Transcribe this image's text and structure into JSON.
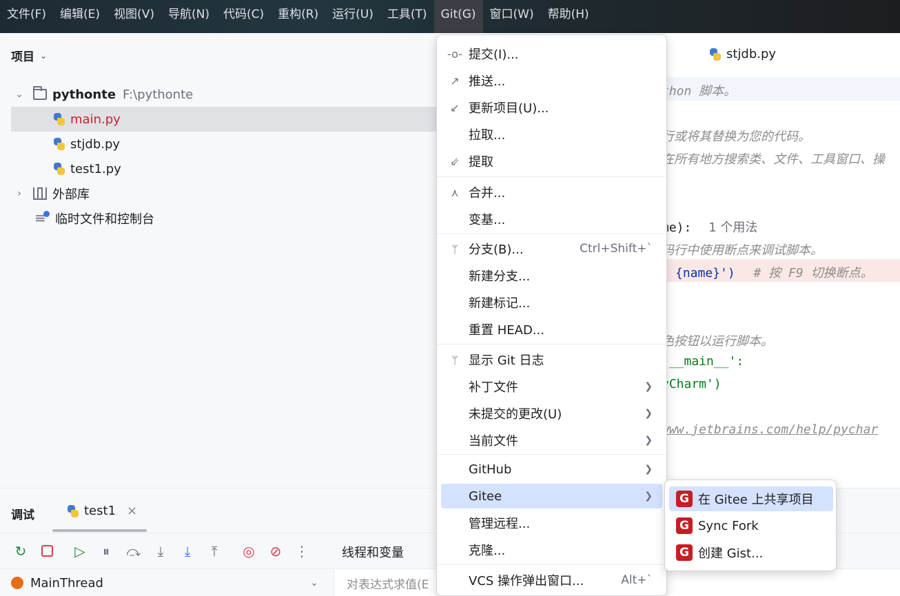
{
  "menubar": {
    "items": [
      "文件(F)",
      "编辑(E)",
      "视图(V)",
      "导航(N)",
      "代码(C)",
      "重构(R)",
      "运行(U)",
      "工具(T)",
      "Git(G)",
      "窗口(W)",
      "帮助(H)"
    ]
  },
  "project": {
    "title": "项目",
    "root_name": "pythonte",
    "root_path": "F:\\pythonte",
    "files": [
      "main.py",
      "stjdb.py",
      "test1.py"
    ],
    "external_libs": "外部库",
    "scratches": "临时文件和控制台"
  },
  "editor": {
    "tab": "stjdb.py",
    "lines": {
      "l1": "thon 脚本。",
      "l2": "行或将其替换为您的代码。",
      "l3": "在所有地方搜索类、文件、工具窗口、操",
      "l4_code": "me):",
      "l4_hint": "1 个用法",
      "l5": "码行中使用断点来调试脚本。",
      "l6_code": "{name}')",
      "l6_comment": "# 按 F9 切换断点。",
      "l7": "色按钮以运行脚本。",
      "l8": "'__main__':",
      "l9": "yCharm')",
      "l10": "www.jetbrains.com/help/pychar"
    }
  },
  "debug": {
    "title": "调试",
    "tab": "test1",
    "threads_tab": "线程和变量",
    "thread": "MainThread",
    "eval_placeholder": "对表达式求值(E"
  },
  "git_menu": {
    "commit": "提交(I)...",
    "push": "推送...",
    "update": "更新项目(U)...",
    "pull": "拉取...",
    "fetch": "提取",
    "merge": "合并...",
    "rebase": "变基...",
    "branches": "分支(B)...",
    "branches_shortcut": "Ctrl+Shift+`",
    "new_branch": "新建分支...",
    "new_tag": "新建标记...",
    "reset_head": "重置 HEAD...",
    "show_log": "显示 Git 日志",
    "patch": "补丁文件",
    "uncommitted": "未提交的更改(U)",
    "current_file": "当前文件",
    "github": "GitHub",
    "gitee": "Gitee",
    "remotes": "管理远程...",
    "clone": "克隆...",
    "vcs_popup": "VCS 操作弹出窗口...",
    "vcs_shortcut": "Alt+`"
  },
  "gitee_menu": {
    "share": "在 Gitee 上共享项目",
    "sync_fork": "Sync Fork",
    "create_gist": "创建 Gist..."
  },
  "colors": {
    "accent_highlight": "#d4e2ff",
    "gitee_red": "#c71d23",
    "selected_file_text": "#c7222d"
  }
}
